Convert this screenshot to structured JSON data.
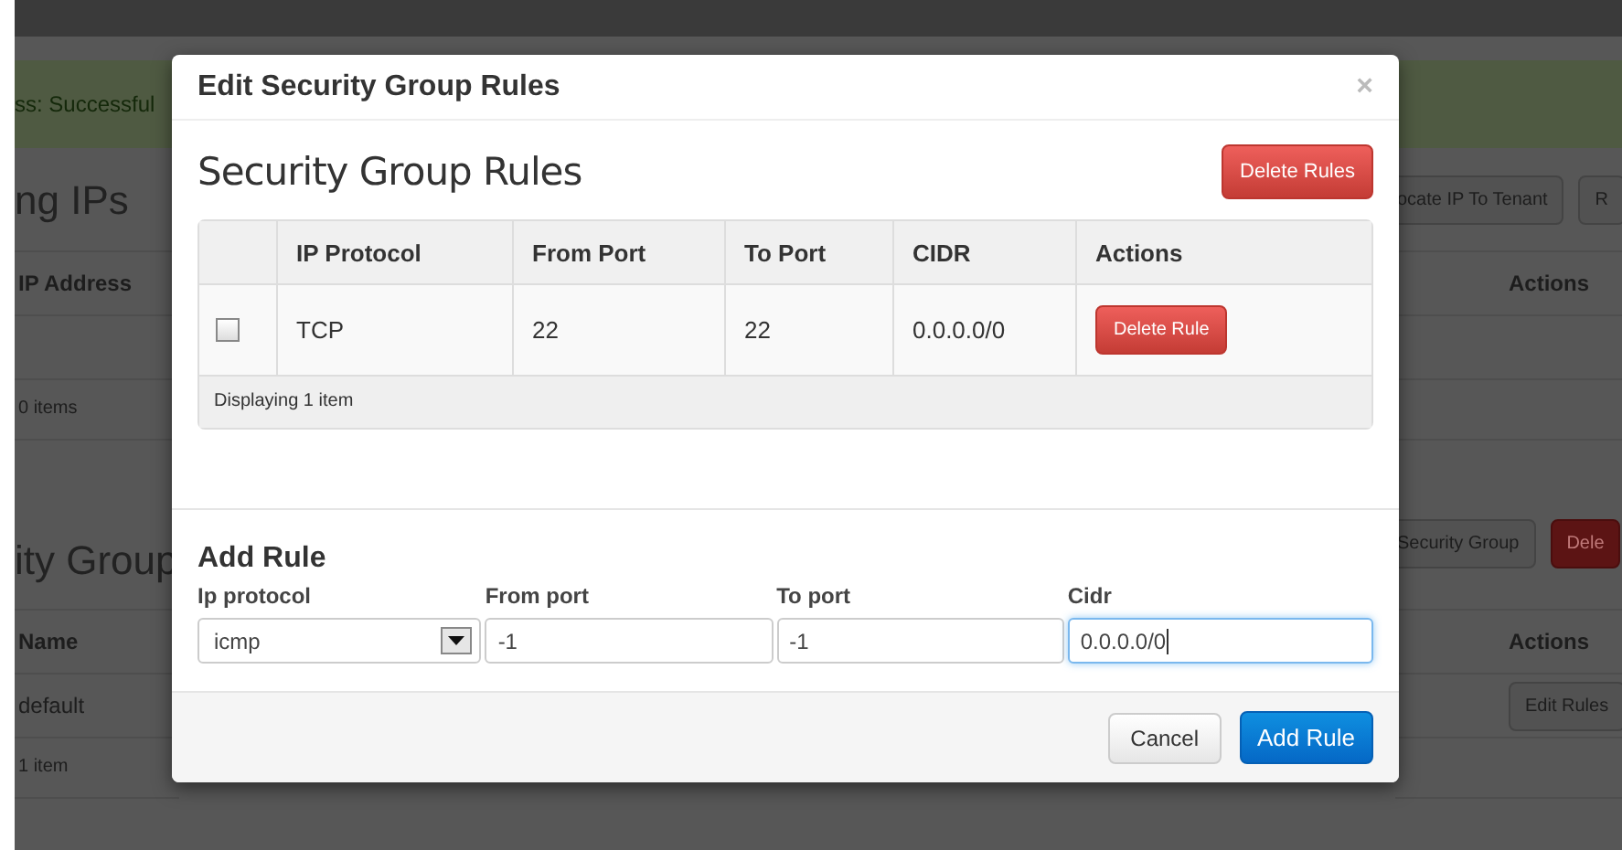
{
  "background_page": {
    "alert": "ss: Successful",
    "left": {
      "heading_1": "ng IPs",
      "column_1": "IP Address",
      "footer_1": "0 items",
      "heading_2": "ity Group",
      "column_2": "Name",
      "cell": "default",
      "footer_2": "1 item"
    },
    "right": {
      "buttons_1": [
        "ocate IP To Tenant",
        "R"
      ],
      "column_1": "Actions",
      "buttons_2": [
        {
          "label": "Security Group",
          "kind": "default"
        },
        {
          "label": "Dele",
          "kind": "danger"
        }
      ],
      "column_2": "Actions",
      "row_button": "Edit Rules"
    }
  },
  "modal": {
    "title": "Edit Security Group Rules",
    "close": "×",
    "heading": "Security Group Rules",
    "delete_button": "Delete Rules",
    "table": {
      "columns": [
        "IP Protocol",
        "From Port",
        "To Port",
        "CIDR",
        "Actions"
      ],
      "rows": [
        {
          "checked": false,
          "cells": [
            "TCP",
            "22",
            "22",
            "0.0.0.0/0"
          ],
          "action": "Delete Rule"
        }
      ],
      "footer": "Displaying 1 item"
    },
    "form": {
      "title": "Add Rule",
      "fields": [
        {
          "label": "Ip protocol",
          "kind": "select",
          "value": "icmp",
          "focused": false
        },
        {
          "label": "From port",
          "kind": "text",
          "value": "-1",
          "focused": false
        },
        {
          "label": "To port",
          "kind": "text",
          "value": "-1",
          "focused": false
        },
        {
          "label": "Cidr",
          "kind": "text",
          "value": "0.0.0.0/0",
          "focused": true
        }
      ]
    },
    "buttons": [
      {
        "label": "Cancel",
        "kind": "default"
      },
      {
        "label": "Add Rule",
        "kind": "primary"
      }
    ]
  }
}
